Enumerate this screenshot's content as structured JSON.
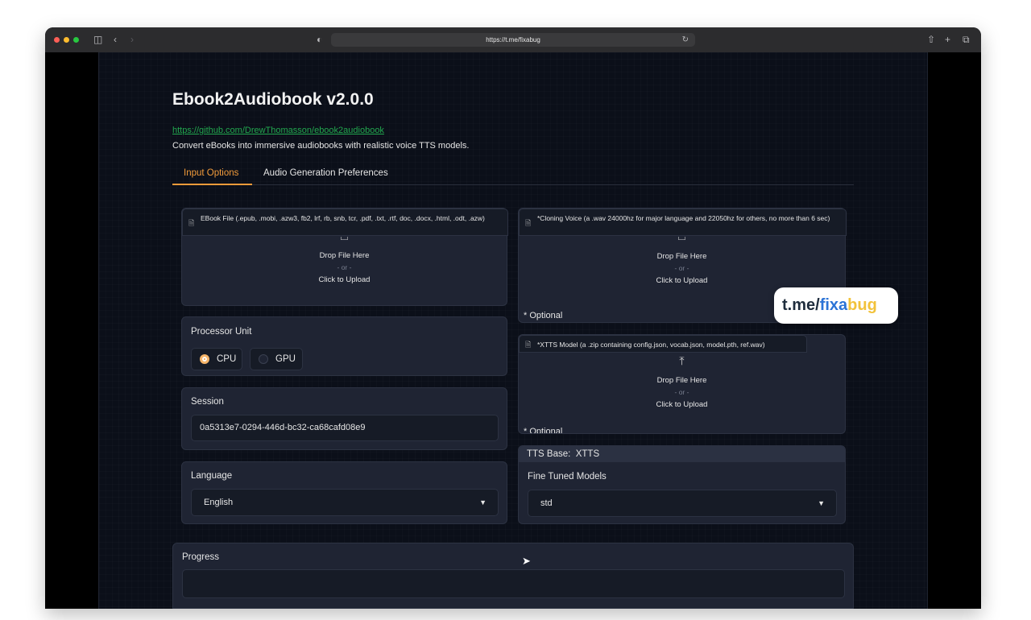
{
  "browser": {
    "url": "https://t.me/fixabug"
  },
  "app": {
    "title": "Ebook2Audiobook v2.0.0",
    "link": "https://github.com/DrewThomasson/ebook2audiobook",
    "description": "Convert eBooks into immersive audiobooks with realistic voice TTS models.",
    "tabs": [
      "Input Options",
      "Audio Generation Preferences"
    ]
  },
  "ebook_upload": {
    "label": "EBook File (.epub, .mobi, .azw3, fb2, lrf, rb, snb, tcr, .pdf, .txt, .rtf, doc, .docx, .html, .odt, .azw)",
    "drop": "Drop File Here",
    "or": "- or -",
    "click": "Click to Upload"
  },
  "voice_upload": {
    "label": "*Cloning Voice (a .wav 24000hz for major language and 22050hz for others, no more than 6 sec)",
    "drop": "Drop File Here",
    "or": "- or -",
    "click": "Click to Upload",
    "optional": "* Optional"
  },
  "processor": {
    "label": "Processor Unit",
    "options": [
      "CPU",
      "GPU"
    ],
    "selected": "CPU"
  },
  "session": {
    "label": "Session",
    "value": "0a5313e7-0294-446d-bc32-ca68cafd08e9"
  },
  "xtts_upload": {
    "label": "*XTTS Model (a .zip containing config.json, vocab.json, model.pth, ref.wav)",
    "drop": "Drop File Here",
    "or": "- or -",
    "click": "Click to Upload",
    "optional": "* Optional"
  },
  "tts": {
    "base_label": "TTS Base:",
    "base_value": "XTTS",
    "fine_tuned_label": "Fine Tuned Models",
    "fine_tuned_value": "std"
  },
  "language": {
    "label": "Language",
    "value": "English"
  },
  "progress": {
    "label": "Progress"
  },
  "watermark": {
    "part1": "t.me/",
    "part2": "fixa",
    "part3": "bug"
  }
}
